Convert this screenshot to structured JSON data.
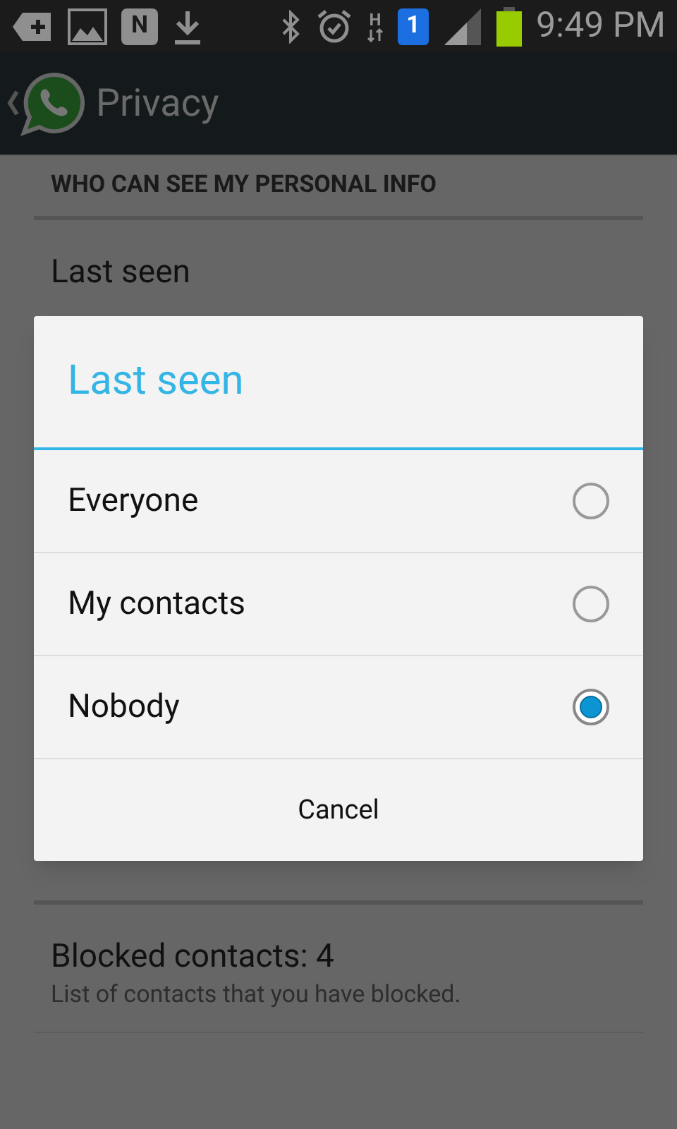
{
  "status_bar": {
    "news_badge": "N",
    "network_type": "H",
    "sim_badge": "1",
    "time": "9:49 PM"
  },
  "action_bar": {
    "title": "Privacy"
  },
  "sections": [
    {
      "header": "WHO CAN SEE MY PERSONAL INFO",
      "items": [
        {
          "title": "Last seen"
        }
      ]
    },
    {
      "items": [
        {
          "title": "Blocked contacts: 4",
          "summary": "List of contacts that you have blocked."
        }
      ]
    }
  ],
  "dialog": {
    "title": "Last seen",
    "options": [
      {
        "label": "Everyone",
        "selected": false
      },
      {
        "label": "My contacts",
        "selected": false
      },
      {
        "label": "Nobody",
        "selected": true
      }
    ],
    "cancel": "Cancel"
  }
}
